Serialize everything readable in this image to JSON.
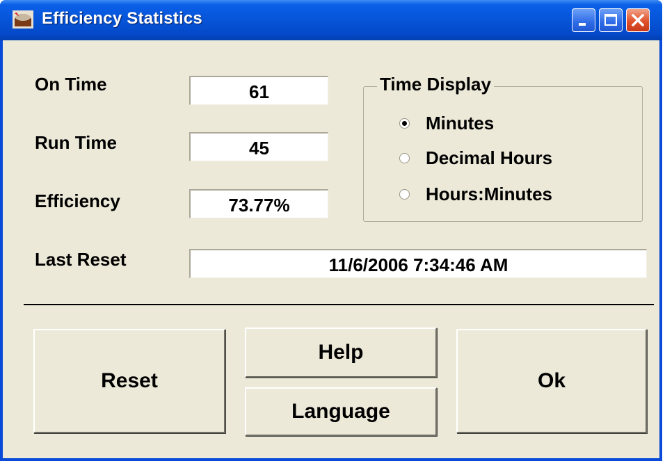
{
  "window": {
    "title": "Efficiency Statistics",
    "app_icon": "coffee-cup-icon"
  },
  "fields": {
    "on_time_label": "On Time",
    "on_time_value": "61",
    "run_time_label": "Run Time",
    "run_time_value": "45",
    "efficiency_label": "Efficiency",
    "efficiency_value": "73.77%",
    "last_reset_label": "Last Reset",
    "last_reset_value": "11/6/2006 7:34:46 AM"
  },
  "time_display": {
    "legend": "Time Display",
    "options": [
      "Minutes",
      "Decimal Hours",
      "Hours:Minutes"
    ],
    "selected": "Minutes"
  },
  "buttons": {
    "reset": "Reset",
    "help": "Help",
    "language": "Language",
    "ok": "Ok"
  },
  "colors": {
    "title_bar": "#0654d8",
    "client_bg": "#ece9d8",
    "close_button": "#e0522c"
  }
}
